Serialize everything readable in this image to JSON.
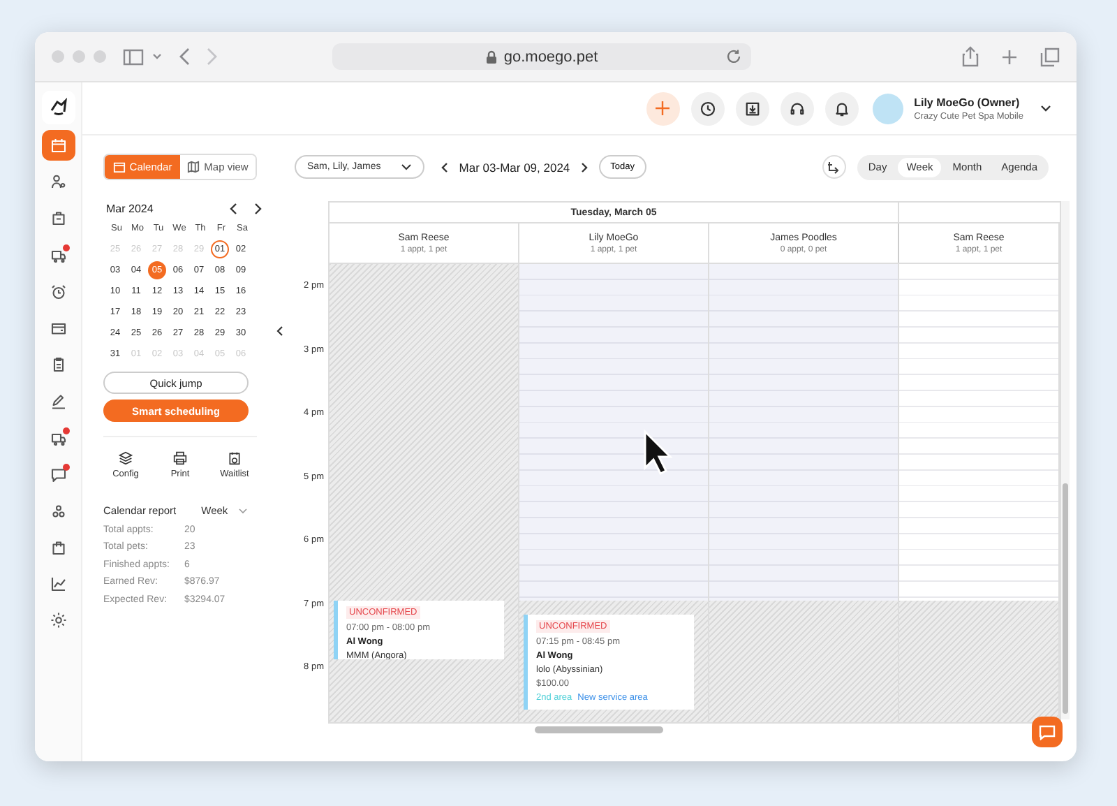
{
  "browser": {
    "url": "go.moego.pet"
  },
  "sidebar": {
    "items": [
      {
        "active": true,
        "badge": false
      },
      {
        "active": false,
        "badge": false
      },
      {
        "active": false,
        "badge": false
      },
      {
        "active": false,
        "badge": true
      },
      {
        "active": false,
        "badge": false
      },
      {
        "active": false,
        "badge": false
      },
      {
        "active": false,
        "badge": false
      },
      {
        "active": false,
        "badge": false
      },
      {
        "active": false,
        "badge": true
      },
      {
        "active": false,
        "badge": true
      },
      {
        "active": false,
        "badge": false
      },
      {
        "active": false,
        "badge": false
      },
      {
        "active": false,
        "badge": false
      },
      {
        "active": false,
        "badge": false
      }
    ]
  },
  "header": {
    "user_name": "Lily MoeGo (Owner)",
    "business": "Crazy Cute Pet Spa Mobile"
  },
  "view_tabs": [
    {
      "label": "Calendar",
      "selected": true
    },
    {
      "label": "Map view",
      "selected": false
    }
  ],
  "mini_calendar": {
    "month": "Mar 2024",
    "weekdays": [
      "Su",
      "Mo",
      "Tu",
      "We",
      "Th",
      "Fr",
      "Sa"
    ],
    "weeks": [
      [
        {
          "day": "25",
          "muted": true,
          "selected": false,
          "outlined": false
        },
        {
          "day": "26",
          "muted": true,
          "selected": false,
          "outlined": false
        },
        {
          "day": "27",
          "muted": true,
          "selected": false,
          "outlined": false
        },
        {
          "day": "28",
          "muted": true,
          "selected": false,
          "outlined": false
        },
        {
          "day": "29",
          "muted": true,
          "selected": false,
          "outlined": false
        },
        {
          "day": "01",
          "muted": false,
          "selected": false,
          "outlined": true
        },
        {
          "day": "02",
          "muted": false,
          "selected": false,
          "outlined": false
        }
      ],
      [
        {
          "day": "03",
          "muted": false,
          "selected": false,
          "outlined": false
        },
        {
          "day": "04",
          "muted": false,
          "selected": false,
          "outlined": false
        },
        {
          "day": "05",
          "muted": false,
          "selected": true,
          "outlined": false
        },
        {
          "day": "06",
          "muted": false,
          "selected": false,
          "outlined": false
        },
        {
          "day": "07",
          "muted": false,
          "selected": false,
          "outlined": false
        },
        {
          "day": "08",
          "muted": false,
          "selected": false,
          "outlined": false
        },
        {
          "day": "09",
          "muted": false,
          "selected": false,
          "outlined": false
        }
      ],
      [
        {
          "day": "10",
          "muted": false,
          "selected": false,
          "outlined": false
        },
        {
          "day": "11",
          "muted": false,
          "selected": false,
          "outlined": false
        },
        {
          "day": "12",
          "muted": false,
          "selected": false,
          "outlined": false
        },
        {
          "day": "13",
          "muted": false,
          "selected": false,
          "outlined": false
        },
        {
          "day": "14",
          "muted": false,
          "selected": false,
          "outlined": false
        },
        {
          "day": "15",
          "muted": false,
          "selected": false,
          "outlined": false
        },
        {
          "day": "16",
          "muted": false,
          "selected": false,
          "outlined": false
        }
      ],
      [
        {
          "day": "17",
          "muted": false,
          "selected": false,
          "outlined": false
        },
        {
          "day": "18",
          "muted": false,
          "selected": false,
          "outlined": false
        },
        {
          "day": "19",
          "muted": false,
          "selected": false,
          "outlined": false
        },
        {
          "day": "20",
          "muted": false,
          "selected": false,
          "outlined": false
        },
        {
          "day": "21",
          "muted": false,
          "selected": false,
          "outlined": false
        },
        {
          "day": "22",
          "muted": false,
          "selected": false,
          "outlined": false
        },
        {
          "day": "23",
          "muted": false,
          "selected": false,
          "outlined": false
        }
      ],
      [
        {
          "day": "24",
          "muted": false,
          "selected": false,
          "outlined": false
        },
        {
          "day": "25",
          "muted": false,
          "selected": false,
          "outlined": false
        },
        {
          "day": "26",
          "muted": false,
          "selected": false,
          "outlined": false
        },
        {
          "day": "27",
          "muted": false,
          "selected": false,
          "outlined": false
        },
        {
          "day": "28",
          "muted": false,
          "selected": false,
          "outlined": false
        },
        {
          "day": "29",
          "muted": false,
          "selected": false,
          "outlined": false
        },
        {
          "day": "30",
          "muted": false,
          "selected": false,
          "outlined": false
        }
      ],
      [
        {
          "day": "31",
          "muted": false,
          "selected": false,
          "outlined": false
        },
        {
          "day": "01",
          "muted": true,
          "selected": false,
          "outlined": false
        },
        {
          "day": "02",
          "muted": true,
          "selected": false,
          "outlined": false
        },
        {
          "day": "03",
          "muted": true,
          "selected": false,
          "outlined": false
        },
        {
          "day": "04",
          "muted": true,
          "selected": false,
          "outlined": false
        },
        {
          "day": "05",
          "muted": true,
          "selected": false,
          "outlined": false
        },
        {
          "day": "06",
          "muted": true,
          "selected": false,
          "outlined": false
        }
      ]
    ]
  },
  "quick_jump": "Quick jump",
  "smart_scheduling": "Smart scheduling",
  "tools": [
    {
      "label": "Config"
    },
    {
      "label": "Print"
    },
    {
      "label": "Waitlist"
    }
  ],
  "report": {
    "title": "Calendar report",
    "period": "Week",
    "rows": [
      {
        "label": "Total appts:",
        "value": "20"
      },
      {
        "label": "Total pets:",
        "value": "23"
      },
      {
        "label": "Finished appts:",
        "value": "6"
      },
      {
        "label": "Earned Rev:",
        "value": "$876.97"
      },
      {
        "label": "Expected Rev:",
        "value": "$3294.07"
      }
    ]
  },
  "toolbar": {
    "staff_filter": "Sam, Lily, James",
    "range": "Mar 03-Mar 09, 2024",
    "today": "Today",
    "views": [
      {
        "label": "Day",
        "selected": false
      },
      {
        "label": "Week",
        "selected": true
      },
      {
        "label": "Month",
        "selected": false
      },
      {
        "label": "Agenda",
        "selected": false
      }
    ]
  },
  "calendar": {
    "day_heading": "Tuesday, March 05",
    "columns": [
      {
        "name": "Sam Reese",
        "summary": "1 appt, 1 pet",
        "off_day": true
      },
      {
        "name": "Lily MoeGo",
        "summary": "1 appt, 1 pet",
        "off_day": false
      },
      {
        "name": "James Poodles",
        "summary": "0 appt, 0 pet",
        "off_day": false
      },
      {
        "name": "Sam Reese",
        "summary": "1 appt, 1 pet",
        "off_day": false
      }
    ],
    "time_labels": [
      "2 pm",
      "3 pm",
      "4 pm",
      "5 pm",
      "6 pm",
      "7 pm",
      "8 pm"
    ],
    "appointments": [
      {
        "status": "UNCONFIRMED",
        "time": "07:00 pm - 08:00 pm",
        "client": "Al Wong",
        "pet": "MMM (Angora)"
      },
      {
        "status": "UNCONFIRMED",
        "time": "07:15 pm - 08:45 pm",
        "client": "Al Wong",
        "pet": "lolo (Abyssinian)",
        "price": "$100.00",
        "areas": [
          {
            "label": "2nd area",
            "color": "#4fd0d8"
          },
          {
            "label": "New service area",
            "color": "#3a8fe8"
          }
        ]
      }
    ]
  }
}
